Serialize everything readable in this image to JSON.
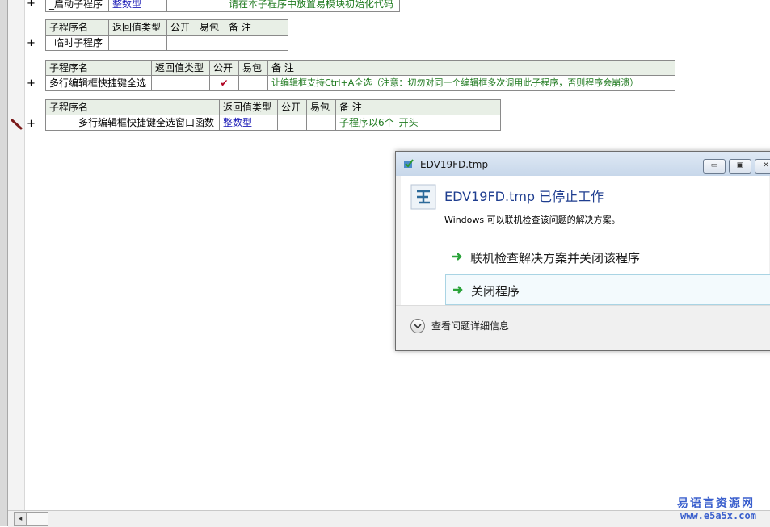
{
  "tables": [
    {
      "rows": [
        {
          "name": "_启动子程序",
          "type": "整数型",
          "public": "",
          "pkg": "",
          "note": "请在本子程序中放置易模块初始化代码"
        }
      ]
    },
    {
      "headers": [
        "子程序名",
        "返回值类型",
        "公开",
        "易包",
        "备 注"
      ],
      "rows": [
        {
          "name": "_临时子程序",
          "type": "",
          "public": "",
          "pkg": "",
          "note": ""
        }
      ]
    },
    {
      "headers": [
        "子程序名",
        "返回值类型",
        "公开",
        "易包",
        "备 注"
      ],
      "rows": [
        {
          "name": "多行编辑框快捷键全选",
          "type": "",
          "public": "✔",
          "pkg": "",
          "note": "让编辑框支持Ctrl+A全选（注意：切勿对同一个编辑框多次调用此子程序，否则程序会崩溃）"
        }
      ]
    },
    {
      "headers": [
        "子程序名",
        "返回值类型",
        "公开",
        "易包",
        "备 注"
      ],
      "rows": [
        {
          "name": "______多行编辑框快捷键全选窗口函数",
          "type": "整数型",
          "public": "",
          "pkg": "",
          "note": "子程序以6个_开头"
        }
      ]
    }
  ],
  "gutter": {
    "plus": "+",
    "marker_icon": "pencil-marker-icon"
  },
  "dialog": {
    "title": "EDV19FD.tmp",
    "main_message": "EDV19FD.tmp 已停止工作",
    "sub_message": "Windows 可以联机检查该问题的解决方案。",
    "option1": "联机检查解决方案并关闭该程序",
    "option2": "关闭程序",
    "details": "查看问题详细信息",
    "btn_min": "▭",
    "btn_max": "▣",
    "btn_close": "✕"
  },
  "scrollbar": {
    "left_arrow": "◂"
  },
  "watermark": {
    "line1": "易语言资源网",
    "line2": "www.e5a5x.com"
  },
  "colors": {
    "accent_blue": "#1e3d8f",
    "arrow_green": "#2aa33a",
    "comment_green": "#1f7a1f",
    "type_blue": "#1a1ab5",
    "header_bg": "#e8efe6"
  }
}
